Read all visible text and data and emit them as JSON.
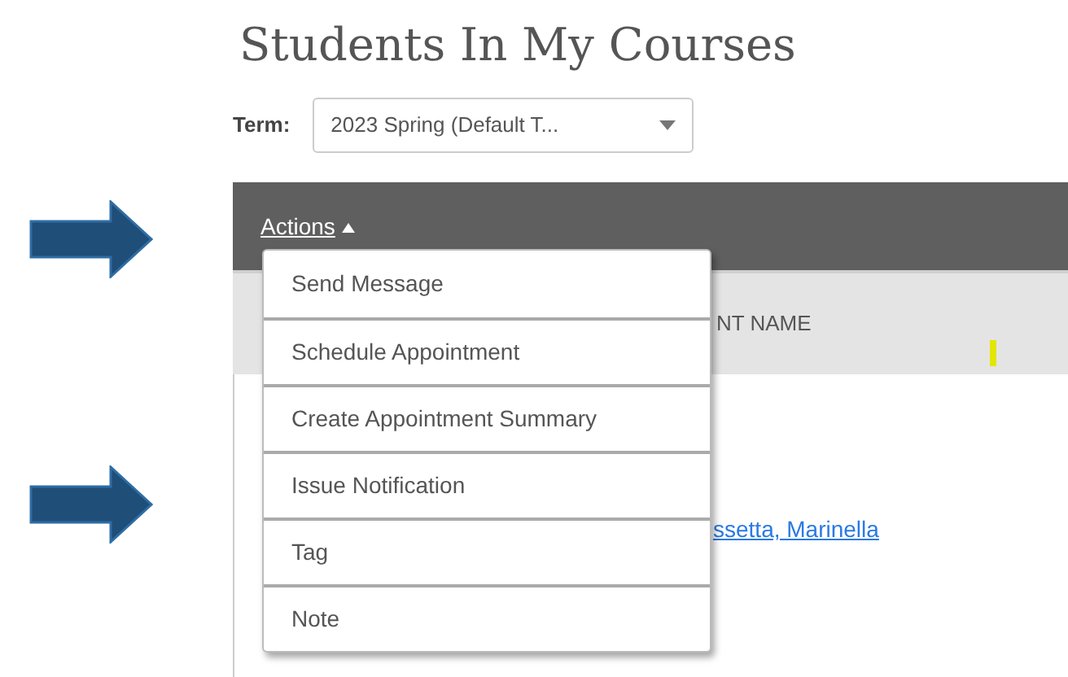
{
  "title": "Students In My Courses",
  "term": {
    "label": "Term:",
    "value": "2023 Spring (Default T..."
  },
  "actions": {
    "label": "Actions",
    "expanded": true,
    "items": [
      {
        "label": "Send Message"
      },
      {
        "label": "Schedule Appointment"
      },
      {
        "label": "Create Appointment Summary"
      },
      {
        "label": "Issue Notification"
      },
      {
        "label": "Tag"
      },
      {
        "label": "Note"
      }
    ]
  },
  "table": {
    "column_header": "NT NAME",
    "rows": [
      {
        "name": "ssetta, Marinella"
      }
    ]
  }
}
